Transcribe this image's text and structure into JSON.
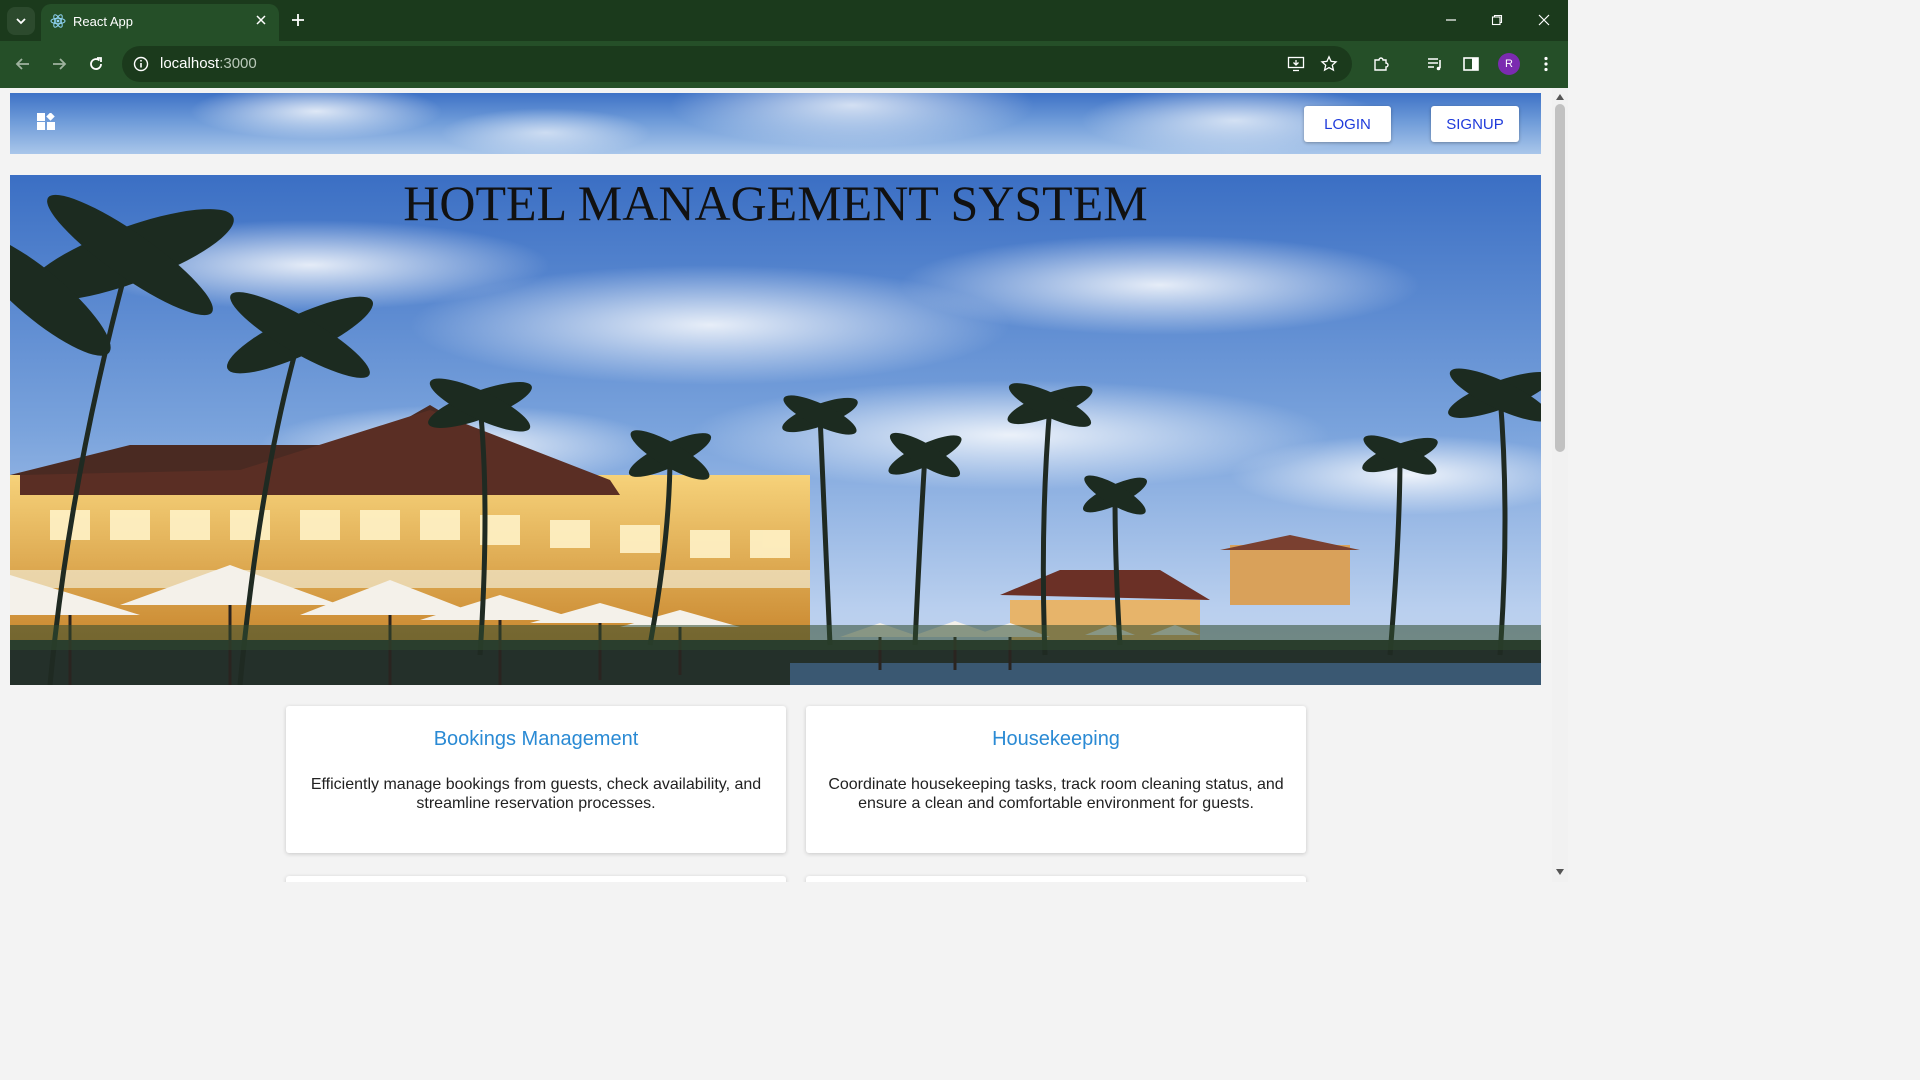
{
  "browser": {
    "tab_title": "React App",
    "url_host": "localhost",
    "url_port": ":3000",
    "profile_initial": "R",
    "theme_colors": {
      "tabbar": "#1b3a1c",
      "toolbar": "#254f28"
    }
  },
  "header": {
    "login_label": "LOGIN",
    "signup_label": "SIGNUP"
  },
  "hero": {
    "title": "HOTEL MANAGEMENT SYSTEM"
  },
  "cards": [
    {
      "title": "Bookings Management",
      "text": "Efficiently manage bookings from guests, check availability, and streamline reservation processes."
    },
    {
      "title": "Housekeeping",
      "text": "Coordinate housekeeping tasks, track room cleaning status, and ensure a clean and comfortable environment for guests."
    }
  ],
  "colors": {
    "accent_link": "#2a8ad4",
    "button_text": "#1e3adb"
  },
  "icons": {
    "tab_search": "chevron-down-icon",
    "favicon": "react-icon",
    "logo": "dashboard-grid-icon"
  }
}
